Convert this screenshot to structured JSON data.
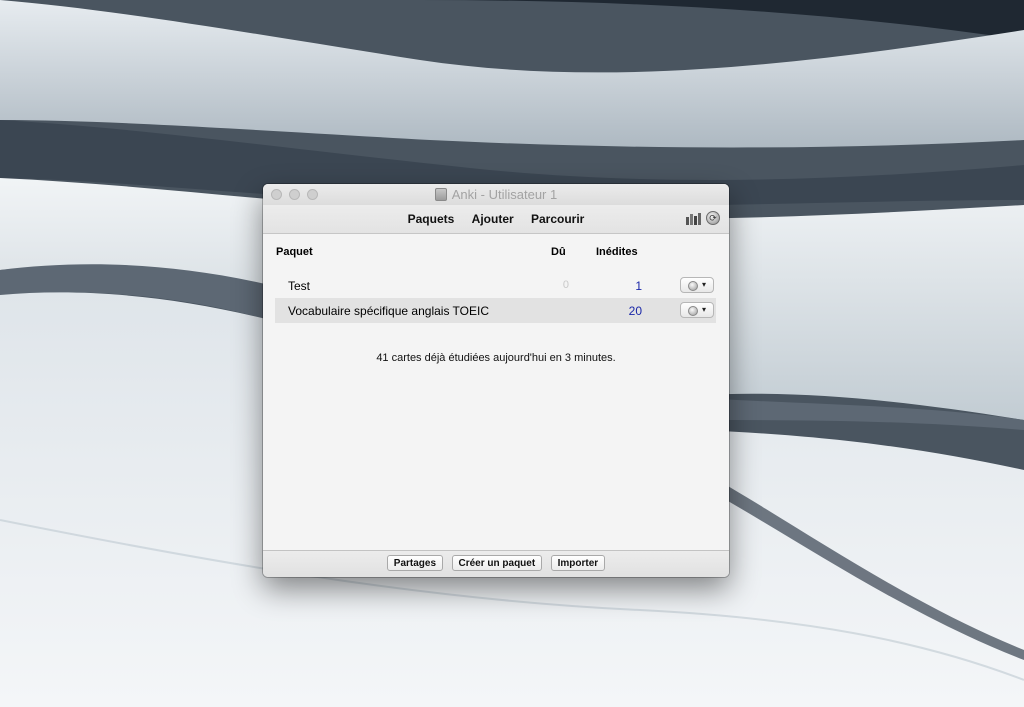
{
  "window": {
    "title": "Anki - Utilisateur 1"
  },
  "toolbar": {
    "nav": [
      "Paquets",
      "Ajouter",
      "Parcourir"
    ],
    "icons": [
      "stats-icon",
      "sync-icon"
    ]
  },
  "table": {
    "headers": {
      "deck": "Paquet",
      "due": "Dû",
      "new": "Inédites"
    },
    "rows": [
      {
        "name": "Test",
        "due": "0",
        "new": "1"
      },
      {
        "name": "Vocabulaire spécifique anglais TOEIC",
        "due": "",
        "new": "20"
      }
    ]
  },
  "summary": "41 cartes déjà étudiées aujourd'hui en 3 minutes.",
  "footer": {
    "buttons": [
      "Partages",
      "Créer un paquet",
      "Importer"
    ]
  },
  "colors": {
    "new_count": "#1a27a8",
    "due_zero": "#c9c9c9",
    "row_highlight": "#e2e2e2"
  }
}
